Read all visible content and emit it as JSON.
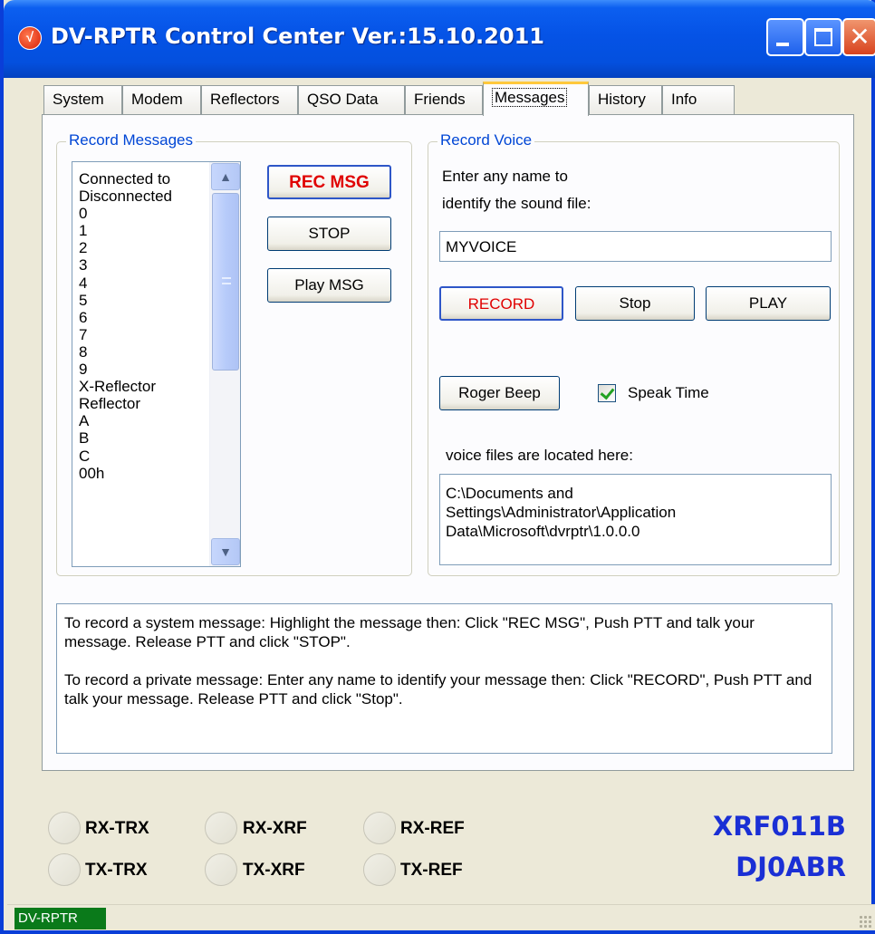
{
  "window": {
    "title": "DV-RPTR Control Center Ver.:15.10.2011",
    "app_icon_glyph": "√"
  },
  "tabs": [
    {
      "label": "System"
    },
    {
      "label": "Modem"
    },
    {
      "label": "Reflectors"
    },
    {
      "label": "QSO Data"
    },
    {
      "label": "Friends"
    },
    {
      "label": "Messages",
      "active": true
    },
    {
      "label": "History"
    },
    {
      "label": "Info"
    }
  ],
  "record_messages": {
    "group_title": "Record Messages",
    "list_items": [
      "Connected to",
      "Disconnected",
      "0",
      "1",
      "2",
      "3",
      "4",
      "5",
      "6",
      "7",
      "8",
      "9",
      "X-Reflector",
      "Reflector",
      "A",
      "B",
      "C",
      "00h"
    ],
    "rec_button": "REC MSG",
    "stop_button": "STOP",
    "play_button": "Play MSG"
  },
  "record_voice": {
    "group_title": "Record Voice",
    "prompt_line1": "Enter any name to",
    "prompt_line2": "identify the sound file:",
    "name_value": "MYVOICE",
    "record_button": "RECORD",
    "stop_button": "Stop",
    "play_button": "PLAY",
    "roger_beep_button": "Roger Beep",
    "speak_time_label": "Speak Time",
    "speak_time_checked": true,
    "location_label": "voice files are located here:",
    "location_path_line1": "C:\\Documents and",
    "location_path_line2": "Settings\\Administrator\\Application",
    "location_path_line3": "Data\\Microsoft\\dvrptr\\1.0.0.0"
  },
  "instructions": {
    "paragraph1": "To record a system message: Highlight the message then: Click \"REC MSG\", Push PTT and talk your message.  Release PTT and click \"STOP\".",
    "paragraph2": "To record a private message: Enter any name to identify your message then: Click \"RECORD\", Push PTT and talk your message.  Release PTT and click \"Stop\"."
  },
  "indicators": {
    "rx_trx": "RX-TRX",
    "rx_xrf": "RX-XRF",
    "rx_ref": "RX-REF",
    "tx_trx": "TX-TRX",
    "tx_xrf": "TX-XRF",
    "tx_ref": "TX-REF"
  },
  "callsigns": {
    "reflector": "XRF011B",
    "station": "DJ0ABR",
    "color": "#1a2fd5"
  },
  "status": {
    "panel_text": "DV-RPTR",
    "panel_color": "#0a7a1a"
  },
  "icons": {
    "scroll_up": "▲",
    "scroll_down": "▼",
    "close": "✕"
  }
}
